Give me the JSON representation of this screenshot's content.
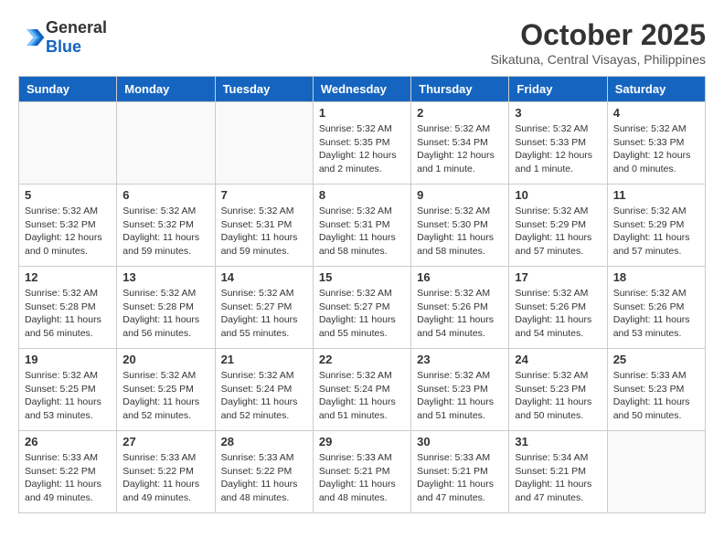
{
  "header": {
    "logo_general": "General",
    "logo_blue": "Blue",
    "month": "October 2025",
    "location": "Sikatuna, Central Visayas, Philippines"
  },
  "weekdays": [
    "Sunday",
    "Monday",
    "Tuesday",
    "Wednesday",
    "Thursday",
    "Friday",
    "Saturday"
  ],
  "weeks": [
    [
      {
        "day": "",
        "sunrise": "",
        "sunset": "",
        "daylight": ""
      },
      {
        "day": "",
        "sunrise": "",
        "sunset": "",
        "daylight": ""
      },
      {
        "day": "",
        "sunrise": "",
        "sunset": "",
        "daylight": ""
      },
      {
        "day": "1",
        "sunrise": "Sunrise: 5:32 AM",
        "sunset": "Sunset: 5:35 PM",
        "daylight": "Daylight: 12 hours and 2 minutes."
      },
      {
        "day": "2",
        "sunrise": "Sunrise: 5:32 AM",
        "sunset": "Sunset: 5:34 PM",
        "daylight": "Daylight: 12 hours and 1 minute."
      },
      {
        "day": "3",
        "sunrise": "Sunrise: 5:32 AM",
        "sunset": "Sunset: 5:33 PM",
        "daylight": "Daylight: 12 hours and 1 minute."
      },
      {
        "day": "4",
        "sunrise": "Sunrise: 5:32 AM",
        "sunset": "Sunset: 5:33 PM",
        "daylight": "Daylight: 12 hours and 0 minutes."
      }
    ],
    [
      {
        "day": "5",
        "sunrise": "Sunrise: 5:32 AM",
        "sunset": "Sunset: 5:32 PM",
        "daylight": "Daylight: 12 hours and 0 minutes."
      },
      {
        "day": "6",
        "sunrise": "Sunrise: 5:32 AM",
        "sunset": "Sunset: 5:32 PM",
        "daylight": "Daylight: 11 hours and 59 minutes."
      },
      {
        "day": "7",
        "sunrise": "Sunrise: 5:32 AM",
        "sunset": "Sunset: 5:31 PM",
        "daylight": "Daylight: 11 hours and 59 minutes."
      },
      {
        "day": "8",
        "sunrise": "Sunrise: 5:32 AM",
        "sunset": "Sunset: 5:31 PM",
        "daylight": "Daylight: 11 hours and 58 minutes."
      },
      {
        "day": "9",
        "sunrise": "Sunrise: 5:32 AM",
        "sunset": "Sunset: 5:30 PM",
        "daylight": "Daylight: 11 hours and 58 minutes."
      },
      {
        "day": "10",
        "sunrise": "Sunrise: 5:32 AM",
        "sunset": "Sunset: 5:29 PM",
        "daylight": "Daylight: 11 hours and 57 minutes."
      },
      {
        "day": "11",
        "sunrise": "Sunrise: 5:32 AM",
        "sunset": "Sunset: 5:29 PM",
        "daylight": "Daylight: 11 hours and 57 minutes."
      }
    ],
    [
      {
        "day": "12",
        "sunrise": "Sunrise: 5:32 AM",
        "sunset": "Sunset: 5:28 PM",
        "daylight": "Daylight: 11 hours and 56 minutes."
      },
      {
        "day": "13",
        "sunrise": "Sunrise: 5:32 AM",
        "sunset": "Sunset: 5:28 PM",
        "daylight": "Daylight: 11 hours and 56 minutes."
      },
      {
        "day": "14",
        "sunrise": "Sunrise: 5:32 AM",
        "sunset": "Sunset: 5:27 PM",
        "daylight": "Daylight: 11 hours and 55 minutes."
      },
      {
        "day": "15",
        "sunrise": "Sunrise: 5:32 AM",
        "sunset": "Sunset: 5:27 PM",
        "daylight": "Daylight: 11 hours and 55 minutes."
      },
      {
        "day": "16",
        "sunrise": "Sunrise: 5:32 AM",
        "sunset": "Sunset: 5:26 PM",
        "daylight": "Daylight: 11 hours and 54 minutes."
      },
      {
        "day": "17",
        "sunrise": "Sunrise: 5:32 AM",
        "sunset": "Sunset: 5:26 PM",
        "daylight": "Daylight: 11 hours and 54 minutes."
      },
      {
        "day": "18",
        "sunrise": "Sunrise: 5:32 AM",
        "sunset": "Sunset: 5:26 PM",
        "daylight": "Daylight: 11 hours and 53 minutes."
      }
    ],
    [
      {
        "day": "19",
        "sunrise": "Sunrise: 5:32 AM",
        "sunset": "Sunset: 5:25 PM",
        "daylight": "Daylight: 11 hours and 53 minutes."
      },
      {
        "day": "20",
        "sunrise": "Sunrise: 5:32 AM",
        "sunset": "Sunset: 5:25 PM",
        "daylight": "Daylight: 11 hours and 52 minutes."
      },
      {
        "day": "21",
        "sunrise": "Sunrise: 5:32 AM",
        "sunset": "Sunset: 5:24 PM",
        "daylight": "Daylight: 11 hours and 52 minutes."
      },
      {
        "day": "22",
        "sunrise": "Sunrise: 5:32 AM",
        "sunset": "Sunset: 5:24 PM",
        "daylight": "Daylight: 11 hours and 51 minutes."
      },
      {
        "day": "23",
        "sunrise": "Sunrise: 5:32 AM",
        "sunset": "Sunset: 5:23 PM",
        "daylight": "Daylight: 11 hours and 51 minutes."
      },
      {
        "day": "24",
        "sunrise": "Sunrise: 5:32 AM",
        "sunset": "Sunset: 5:23 PM",
        "daylight": "Daylight: 11 hours and 50 minutes."
      },
      {
        "day": "25",
        "sunrise": "Sunrise: 5:33 AM",
        "sunset": "Sunset: 5:23 PM",
        "daylight": "Daylight: 11 hours and 50 minutes."
      }
    ],
    [
      {
        "day": "26",
        "sunrise": "Sunrise: 5:33 AM",
        "sunset": "Sunset: 5:22 PM",
        "daylight": "Daylight: 11 hours and 49 minutes."
      },
      {
        "day": "27",
        "sunrise": "Sunrise: 5:33 AM",
        "sunset": "Sunset: 5:22 PM",
        "daylight": "Daylight: 11 hours and 49 minutes."
      },
      {
        "day": "28",
        "sunrise": "Sunrise: 5:33 AM",
        "sunset": "Sunset: 5:22 PM",
        "daylight": "Daylight: 11 hours and 48 minutes."
      },
      {
        "day": "29",
        "sunrise": "Sunrise: 5:33 AM",
        "sunset": "Sunset: 5:21 PM",
        "daylight": "Daylight: 11 hours and 48 minutes."
      },
      {
        "day": "30",
        "sunrise": "Sunrise: 5:33 AM",
        "sunset": "Sunset: 5:21 PM",
        "daylight": "Daylight: 11 hours and 47 minutes."
      },
      {
        "day": "31",
        "sunrise": "Sunrise: 5:34 AM",
        "sunset": "Sunset: 5:21 PM",
        "daylight": "Daylight: 11 hours and 47 minutes."
      },
      {
        "day": "",
        "sunrise": "",
        "sunset": "",
        "daylight": ""
      }
    ]
  ]
}
